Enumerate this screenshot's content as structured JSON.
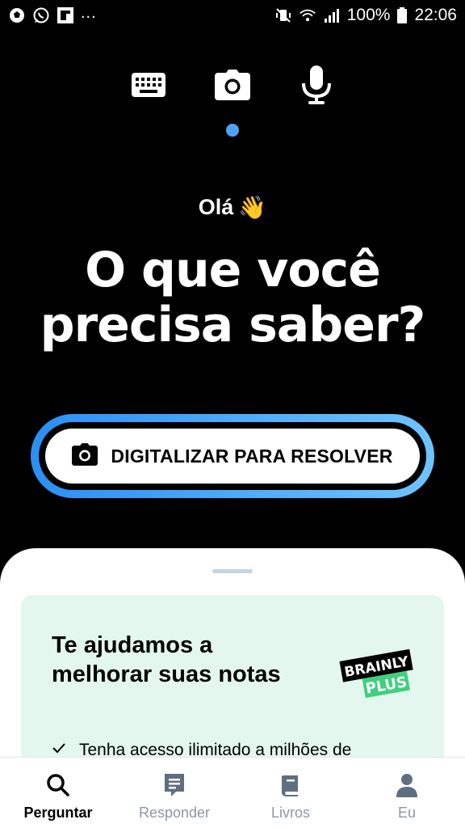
{
  "status_bar": {
    "left_icons": [
      "soccer-ball-icon",
      "whatsapp-icon",
      "flipboard-icon"
    ],
    "overflow": "...",
    "battery": "100%",
    "time": "22:06"
  },
  "input_modes": {
    "items": [
      {
        "name": "keyboard",
        "icon": "keyboard-icon"
      },
      {
        "name": "camera",
        "icon": "camera-icon"
      },
      {
        "name": "microphone",
        "icon": "microphone-icon"
      }
    ],
    "selected": "camera"
  },
  "greeting": {
    "text": "Olá",
    "emoji": "👋"
  },
  "headline": {
    "line1": "O que você",
    "line2": "precisa saber?"
  },
  "scan_button": {
    "label": "DIGITALIZAR PARA RESOLVER",
    "icon": "camera-icon"
  },
  "promo": {
    "title": "Te ajudamos a melhorar suas notas",
    "logo_line1": "BRAINLY",
    "logo_line2": "PLUS",
    "bullet": "Tenha acesso ilimitado a milhões de"
  },
  "bottom_nav": {
    "items": [
      {
        "label": "Perguntar",
        "icon": "search-icon",
        "active": true
      },
      {
        "label": "Responder",
        "icon": "chat-icon",
        "active": false
      },
      {
        "label": "Livros",
        "icon": "book-icon",
        "active": false
      },
      {
        "label": "Eu",
        "icon": "profile-icon",
        "active": false
      }
    ]
  },
  "colors": {
    "background": "#000000",
    "accent_blue": "#2a8ff5",
    "promo_bg": "#e3f7ee",
    "brainly_green": "#3fd07e"
  }
}
